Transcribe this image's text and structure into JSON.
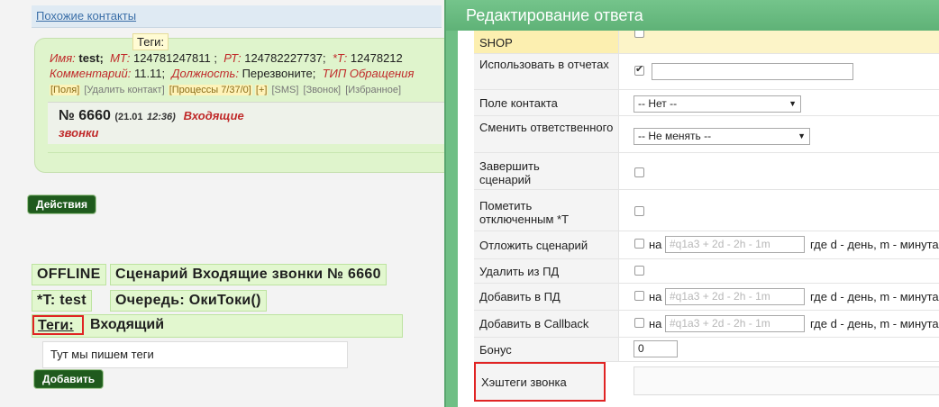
{
  "left": {
    "similar_contacts_link": "Похожие контакты",
    "tooltip": "Теги:",
    "contact": {
      "name_label": "Имя:",
      "name_value": "test;",
      "mt_label": "МТ:",
      "mt_value": "124781247811 ;",
      "rt_label": "РТ:",
      "rt_value": "124782227737;",
      "t_label": "*Т:",
      "t_value": "12478212",
      "comment_label": "Комментарий:",
      "comment_value": "11.11;",
      "position_label": "Должность:",
      "position_value": "Перезвоните;",
      "appeal_label": "ТИП Обращения"
    },
    "actions": {
      "fields": "[Поля]",
      "delete": "[Удалить контакт]",
      "processes": "[Процессы",
      "processes_count": "7/37/0]",
      "plus": "[+]",
      "sms": "[SMS]",
      "call": "[Звонок]",
      "favorite": "[Избранное]"
    },
    "call": {
      "number": "№ 6660",
      "date_open": "(21.01",
      "time": "12:36)",
      "type_line1": "Входящие",
      "type_line2": "звонки"
    },
    "actions_button": "Действия",
    "status": "OFFLINE",
    "scenario": "Сценарий Входящие звонки № 6660",
    "t_info": "*T: test",
    "queue": "Очередь: ОкиТоки()",
    "tags_label": "Теги:",
    "tags_value": "Входящий",
    "tags_input_value": "Тут мы пишем теги",
    "add_button": "Добавить"
  },
  "dialog": {
    "title": "Редактирование ответа",
    "rows": {
      "shop_label": "SHOP",
      "use_in_reports": "Использовать в отчетах",
      "contact_field": "Поле контакта",
      "contact_field_value": "-- Нет --",
      "change_responsible": "Сменить ответственного",
      "change_responsible_value": "-- Не менять --",
      "finish_scenario": "Завершить сценарий",
      "mark_disabled": "Пометить отключенным *Т",
      "postpone_scenario": "Отложить сценарий",
      "remove_from_pd": "Удалить из ПД",
      "add_to_pd": "Добавить в ПД",
      "add_to_callback": "Добавить в Callback",
      "bonus": "Бонус",
      "bonus_value": "0",
      "hashtags": "Хэштеги звонка",
      "on_label": "на",
      "interval_placeholder": "#q1a3 + 2d - 2h - 1m",
      "interval_hint": "где d - день, m - минута"
    }
  }
}
